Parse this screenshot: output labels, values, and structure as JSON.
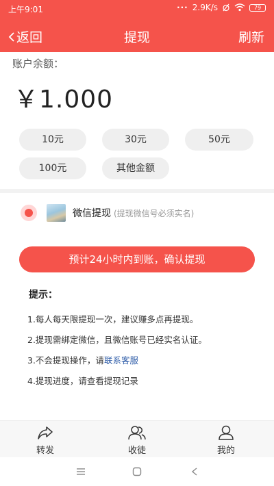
{
  "status_bar": {
    "time": "上午9:01",
    "dots": "···",
    "net_speed": "2.9K/s",
    "battery": "79"
  },
  "navbar": {
    "back_label": "返回",
    "title": "提现",
    "refresh_label": "刷新"
  },
  "balance": {
    "label": "账户余额：",
    "amount": "￥1.000"
  },
  "amount_options": [
    "10元",
    "30元",
    "50元",
    "100元",
    "其他金额"
  ],
  "payment_method": {
    "title": "微信提现",
    "note": "(提现微信号必须实名)"
  },
  "confirm_button": "预计24小时内到账，确认提现",
  "tips": {
    "title": "提示：",
    "items": [
      "1.每人每天限提现一次，建议赚多点再提现。",
      "2.提现需绑定微信，且微信账号已经实名认证。",
      "3.不会提现操作，请",
      "4.提现进度，请查看提现记录"
    ],
    "contact_link": "联系客服"
  },
  "tabbar": [
    "转发",
    "收徒",
    "我的"
  ],
  "colors": {
    "brand": "#f5534b",
    "link": "#2e5ca8"
  }
}
